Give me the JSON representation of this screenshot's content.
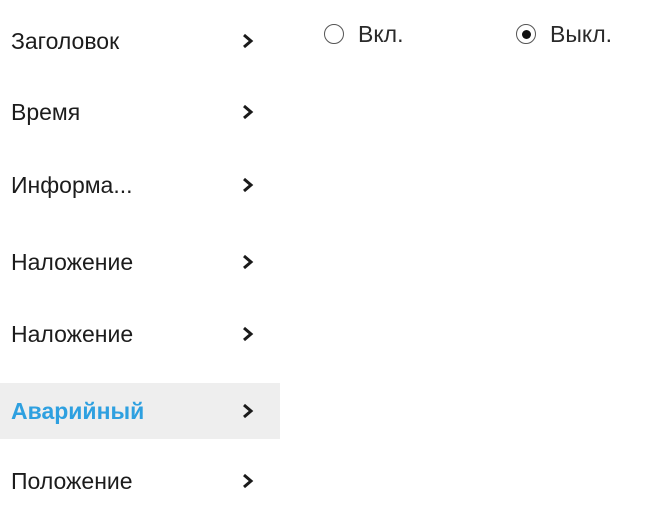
{
  "sidebar": {
    "items": [
      {
        "label": "Заголовок",
        "active": false
      },
      {
        "label": "Время",
        "active": false
      },
      {
        "label": "Информа...",
        "active": false
      },
      {
        "label": "Наложение",
        "active": false
      },
      {
        "label": "Наложение",
        "active": false
      },
      {
        "label": "Аварийный",
        "active": true
      },
      {
        "label": "Положение",
        "active": false
      }
    ],
    "chevron_icon": "chevron-right-icon",
    "active_color": "#2ea0e0",
    "active_background": "#eeeeee"
  },
  "settings": {
    "radio": {
      "options": [
        {
          "label": "Вкл.",
          "checked": false
        },
        {
          "label": "Выкл.",
          "checked": true
        }
      ]
    }
  }
}
